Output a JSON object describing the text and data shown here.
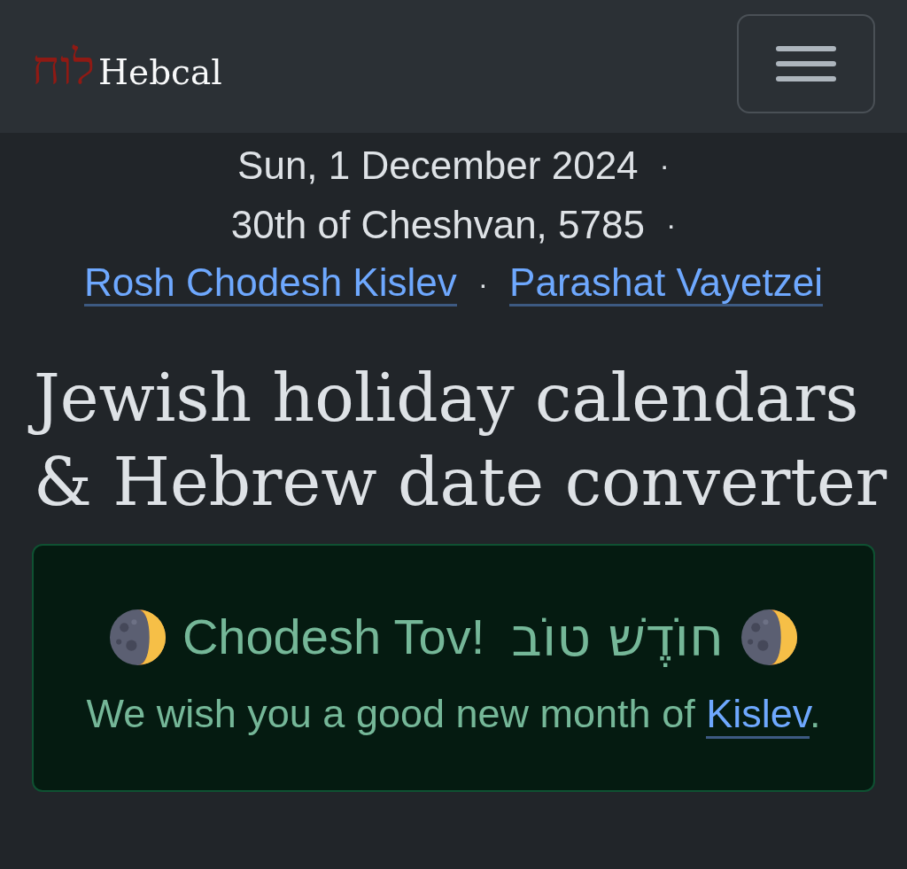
{
  "navbar": {
    "logo_hebrew": "לוח",
    "logo_text": "Hebcal"
  },
  "today": {
    "lines": [
      {
        "items": [
          {
            "kind": "text",
            "text": "Sun, 1 December 2024"
          },
          {
            "kind": "separator",
            "text": "·"
          }
        ]
      },
      {
        "items": [
          {
            "kind": "text",
            "text": "30th of Cheshvan, 5785"
          },
          {
            "kind": "separator",
            "text": "·"
          }
        ]
      },
      {
        "items": [
          {
            "kind": "link",
            "text": "Rosh Chodesh Kislev"
          },
          {
            "kind": "separator",
            "text": "·"
          },
          {
            "kind": "link",
            "text": "Parashat Vayetzei"
          }
        ]
      }
    ]
  },
  "heading": "Jewish holiday calendars & Hebrew date converter",
  "alert": {
    "title": "Chodesh Tov!",
    "title_hebrew": "חוֹדֶשׁ טוֹב",
    "message": {
      "before": "We wish you a good new month of ",
      "link": "Kislev",
      "after": "."
    }
  }
}
